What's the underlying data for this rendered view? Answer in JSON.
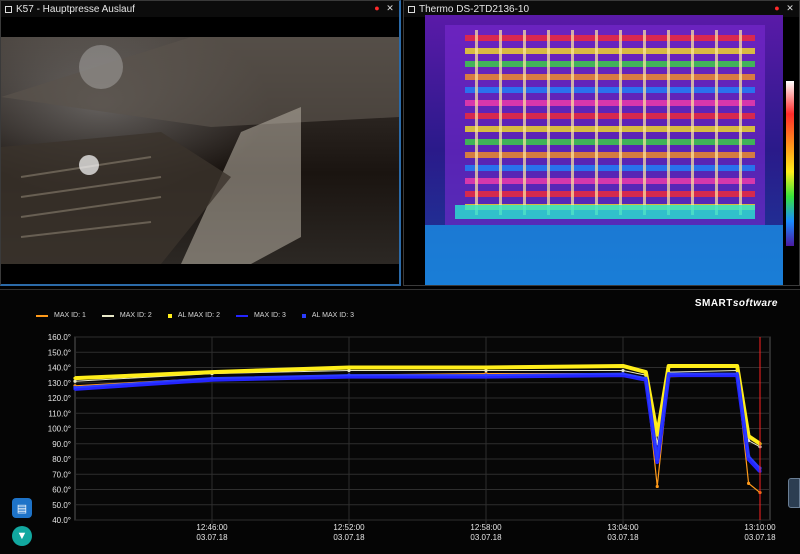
{
  "camera_window": {
    "title": "K57 - Hauptpresse Auslauf",
    "controls": [
      "record-icon",
      "close-icon"
    ]
  },
  "thermo_window": {
    "title": "Thermo DS-2TD2136-10",
    "controls": [
      "record-icon",
      "close-icon"
    ]
  },
  "brand": {
    "smart": "SMART",
    "software": "software"
  },
  "colors": {
    "max1": "#ff9a1a",
    "max2": "#e8e8c8",
    "al_max2": "#ffee1a",
    "max3": "#2424ff",
    "al_max3": "#2a3cff",
    "marker": "#ff2020"
  },
  "legend": [
    {
      "label": "MAX ID: 1",
      "style": "line",
      "color": "#ff9a1a"
    },
    {
      "label": "MAX ID: 2",
      "style": "line",
      "color": "#e8e8c8"
    },
    {
      "label": "AL MAX ID: 2",
      "style": "dot",
      "color": "#ffee1a"
    },
    {
      "label": "MAX ID: 3",
      "style": "line",
      "color": "#2424ff"
    },
    {
      "label": "AL MAX ID: 3",
      "style": "dot",
      "color": "#2a3cff"
    }
  ],
  "chart_data": {
    "type": "line",
    "ylim": [
      40,
      160
    ],
    "y_ticks": [
      "40.0°",
      "50.0°",
      "60.0°",
      "70.0°",
      "80.0°",
      "90.0°",
      "100.0°",
      "110.0°",
      "120.0°",
      "130.0°",
      "140.0°",
      "150.0°",
      "160.0°"
    ],
    "x_ticks": [
      {
        "time": "12:46:00",
        "date": "03.07.18"
      },
      {
        "time": "12:52:00",
        "date": "03.07.18"
      },
      {
        "time": "12:58:00",
        "date": "03.07.18"
      },
      {
        "time": "13:04:00",
        "date": "03.07.18"
      },
      {
        "time": "13:10:00",
        "date": "03.07.18"
      }
    ],
    "xlim_minutes": [
      "12:40:00",
      "13:10:00"
    ],
    "grid": true,
    "series": [
      {
        "name": "MAX ID: 1",
        "x": [
          "12:40",
          "12:46",
          "12:52",
          "12:58",
          "13:04",
          "13:05",
          "13:05.5",
          "13:06",
          "13:09",
          "13:09.5",
          "13:10"
        ],
        "values": [
          128,
          133,
          135,
          136,
          136,
          133,
          62,
          134,
          135,
          64,
          58
        ]
      },
      {
        "name": "MAX ID: 2",
        "x": [
          "12:40",
          "12:46",
          "12:52",
          "12:58",
          "13:04",
          "13:05",
          "13:05.5",
          "13:06",
          "13:09",
          "13:09.5",
          "13:10"
        ],
        "values": [
          131,
          136,
          138,
          138,
          138,
          135,
          90,
          137,
          138,
          92,
          88
        ]
      },
      {
        "name": "AL MAX ID: 2",
        "x": [
          "12:40",
          "12:46",
          "12:52",
          "12:58",
          "13:04",
          "13:05",
          "13:05.5",
          "13:06",
          "13:09",
          "13:09.5",
          "13:10"
        ],
        "values": [
          133,
          137,
          140,
          140,
          141,
          137,
          96,
          141,
          141,
          95,
          90
        ]
      },
      {
        "name": "MAX ID: 3",
        "x": [
          "12:40",
          "12:46",
          "12:52",
          "12:58",
          "13:04",
          "13:05",
          "13:05.5",
          "13:06",
          "13:09",
          "13:09.5",
          "13:10"
        ],
        "values": [
          126,
          132,
          134,
          134,
          135,
          132,
          78,
          135,
          135,
          80,
          72
        ]
      },
      {
        "name": "AL MAX ID: 3",
        "x": [
          "12:40",
          "12:46",
          "12:52",
          "12:58",
          "13:04",
          "13:05",
          "13:05.5",
          "13:06",
          "13:09",
          "13:09.5",
          "13:10"
        ],
        "values": [
          127,
          133,
          135,
          135,
          136,
          133,
          80,
          136,
          136,
          82,
          74
        ]
      }
    ],
    "current_marker": "13:10:00"
  }
}
